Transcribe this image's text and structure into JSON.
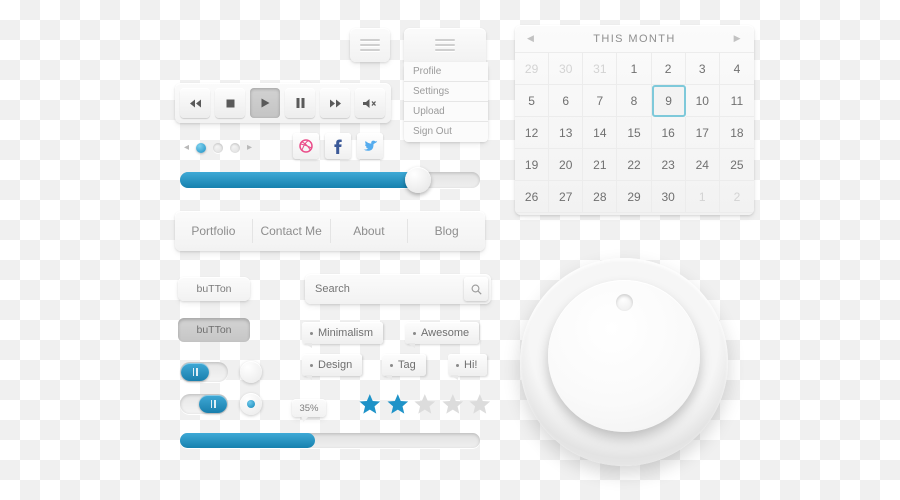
{
  "media_player": {
    "buttons": [
      {
        "name": "rewind-button",
        "icon": "rewind-icon",
        "state": "normal"
      },
      {
        "name": "stop-button",
        "icon": "stop-icon",
        "state": "normal"
      },
      {
        "name": "play-button",
        "icon": "play-icon",
        "state": "pressed"
      },
      {
        "name": "pause-button",
        "icon": "pause-icon",
        "state": "normal"
      },
      {
        "name": "fast-forward-button",
        "icon": "fast-forward-icon",
        "state": "normal"
      },
      {
        "name": "mute-button",
        "icon": "speaker-mute-icon",
        "state": "normal"
      }
    ]
  },
  "carousel": {
    "prev_icon": "◂",
    "next_icon": "▸",
    "dots": [
      {
        "active": true
      },
      {
        "active": false
      },
      {
        "active": false
      }
    ]
  },
  "social": {
    "items": [
      {
        "name": "dribbble-icon",
        "glyph": "⊕",
        "color": "#ea4c89"
      },
      {
        "name": "facebook-icon",
        "glyph": "f",
        "color": "#3b5998"
      },
      {
        "name": "twitter-icon",
        "glyph": "ᴠ",
        "color": "#55acee"
      }
    ]
  },
  "hamburger": {
    "plain_label": "menu-icon",
    "dropdown_label": "menu-icon"
  },
  "dropdown": {
    "items": [
      "Profile",
      "Settings",
      "Upload",
      "Sign Out"
    ]
  },
  "slider": {
    "value": 78,
    "fill_color": "#2392c4"
  },
  "navbar": {
    "items": [
      "Portfolio",
      "Contact Me",
      "About",
      "Blog"
    ]
  },
  "buttons": {
    "normal_label": "buTTon",
    "pressed_label": "buTTon"
  },
  "search": {
    "placeholder": "Search",
    "value": "",
    "icon": "search-icon"
  },
  "tags": [
    {
      "label": "Minimalism"
    },
    {
      "label": "Awesome"
    },
    {
      "label": "Design"
    },
    {
      "label": "Tag"
    },
    {
      "label": "Hi!"
    }
  ],
  "toggles": [
    {
      "name": "toggle-switch-on",
      "position": "left",
      "on": true
    },
    {
      "name": "toggle-switch-off",
      "position": "right",
      "on": false
    }
  ],
  "radios": [
    {
      "name": "radio-unchecked",
      "checked": false
    },
    {
      "name": "radio-checked",
      "checked": true
    }
  ],
  "tooltip": {
    "text": "35%"
  },
  "rating": {
    "value": 2,
    "max": 5,
    "filled_color": "#1f93c8",
    "empty_color": "#d8d8d8"
  },
  "progress": {
    "value": 45,
    "fill_color": "#2392c4"
  },
  "calendar": {
    "title": "THIS MONTH",
    "prev_icon": "◀",
    "next_icon": "▶",
    "selected_day": "9",
    "days": [
      {
        "d": "29",
        "muted": true
      },
      {
        "d": "30",
        "muted": true
      },
      {
        "d": "31",
        "muted": true
      },
      {
        "d": "1"
      },
      {
        "d": "2"
      },
      {
        "d": "3"
      },
      {
        "d": "4"
      },
      {
        "d": "5"
      },
      {
        "d": "6"
      },
      {
        "d": "7"
      },
      {
        "d": "8"
      },
      {
        "d": "9",
        "today": true
      },
      {
        "d": "10"
      },
      {
        "d": "11"
      },
      {
        "d": "12"
      },
      {
        "d": "13"
      },
      {
        "d": "14"
      },
      {
        "d": "15"
      },
      {
        "d": "16"
      },
      {
        "d": "17"
      },
      {
        "d": "18"
      },
      {
        "d": "19"
      },
      {
        "d": "20"
      },
      {
        "d": "21"
      },
      {
        "d": "22"
      },
      {
        "d": "23"
      },
      {
        "d": "24"
      },
      {
        "d": "25"
      },
      {
        "d": "26"
      },
      {
        "d": "27"
      },
      {
        "d": "28"
      },
      {
        "d": "29"
      },
      {
        "d": "30"
      },
      {
        "d": "1",
        "muted": true
      },
      {
        "d": "2",
        "muted": true
      }
    ]
  },
  "knob": {
    "name": "rotary-knob",
    "indicator": "knob-indicator-dot"
  },
  "colors": {
    "accent_blue": "#2392c4",
    "panel_light": "#f5f5f5",
    "text_gray": "#8d8d8d",
    "selected_border": "#7ec9da"
  }
}
